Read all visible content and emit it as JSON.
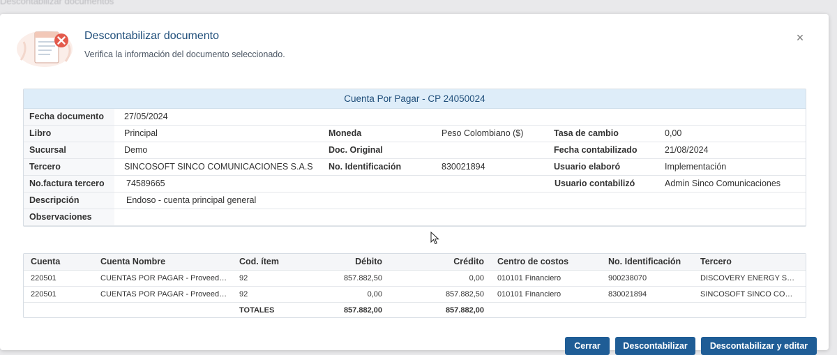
{
  "background": {
    "title": "Descontabilizar documentos"
  },
  "dialog": {
    "title": "Descontabilizar documento",
    "subtitle": "Verifica la información del documento seleccionado.",
    "close_icon": "×"
  },
  "document": {
    "heading": "Cuenta Por Pagar - CP 24050024",
    "fields": {
      "fecha_documento": {
        "label": "Fecha documento",
        "value": "27/05/2024"
      },
      "libro": {
        "label": "Libro",
        "value": "Principal"
      },
      "moneda": {
        "label": "Moneda",
        "value": "Peso Colombiano ($)"
      },
      "tasa_cambio": {
        "label": "Tasa de cambio",
        "value": "0,00"
      },
      "sucursal": {
        "label": "Sucursal",
        "value": "Demo"
      },
      "doc_original": {
        "label": "Doc. Original",
        "value": ""
      },
      "fecha_contabilizado": {
        "label": "Fecha contabilizado",
        "value": "21/08/2024"
      },
      "tercero": {
        "label": "Tercero",
        "value": "SINCOSOFT SINCO COMUNICACIONES S.A.S"
      },
      "no_identificacion": {
        "label": "No. Identificación",
        "value": "830021894"
      },
      "usuario_elaboro": {
        "label": "Usuario elaboró",
        "value": "Implementación"
      },
      "no_factura": {
        "label": "No.factura tercero",
        "value": "74589665"
      },
      "usuario_contabilizo": {
        "label": "Usuario contabilizó",
        "value": "Admin Sinco Comunicaciones"
      },
      "descripcion": {
        "label": "Descripción",
        "value": "Endoso - cuenta principal general"
      },
      "observaciones": {
        "label": "Observaciones",
        "value": ""
      }
    }
  },
  "table": {
    "columns": [
      "Cuenta",
      "Cuenta Nombre",
      "Cod. ítem",
      "Débito",
      "Crédito",
      "Centro de costos",
      "No. Identificación",
      "Tercero"
    ],
    "rows": [
      [
        "220501",
        "CUENTAS POR PAGAR - Proveedores Nacionales",
        "92",
        "857.882,50",
        "0,00",
        "010101 Financiero",
        "900238070",
        "DISCOVERY ENERGY SERVICES S.A.S"
      ],
      [
        "220501",
        "CUENTAS POR PAGAR - Proveedores Nacionales",
        "92",
        "0,00",
        "857.882,50",
        "010101 Financiero",
        "830021894",
        "SINCOSOFT SINCO COMUNICACIONES S.A.S"
      ]
    ],
    "totals": {
      "label": "TOTALES",
      "debito": "857.882,00",
      "credito": "857.882,00"
    }
  },
  "buttons": {
    "cerrar": "Cerrar",
    "descontabilizar": "Descontabilizar",
    "descontabilizar_editar": "Descontabilizar y editar"
  },
  "colors": {
    "accent": "#1f5d96",
    "title": "#1f4e7a",
    "header_band": "#deedf9"
  },
  "icons": {
    "header": "document-remove-icon",
    "close": "close-icon",
    "cursor": "mouse-pointer-icon"
  }
}
